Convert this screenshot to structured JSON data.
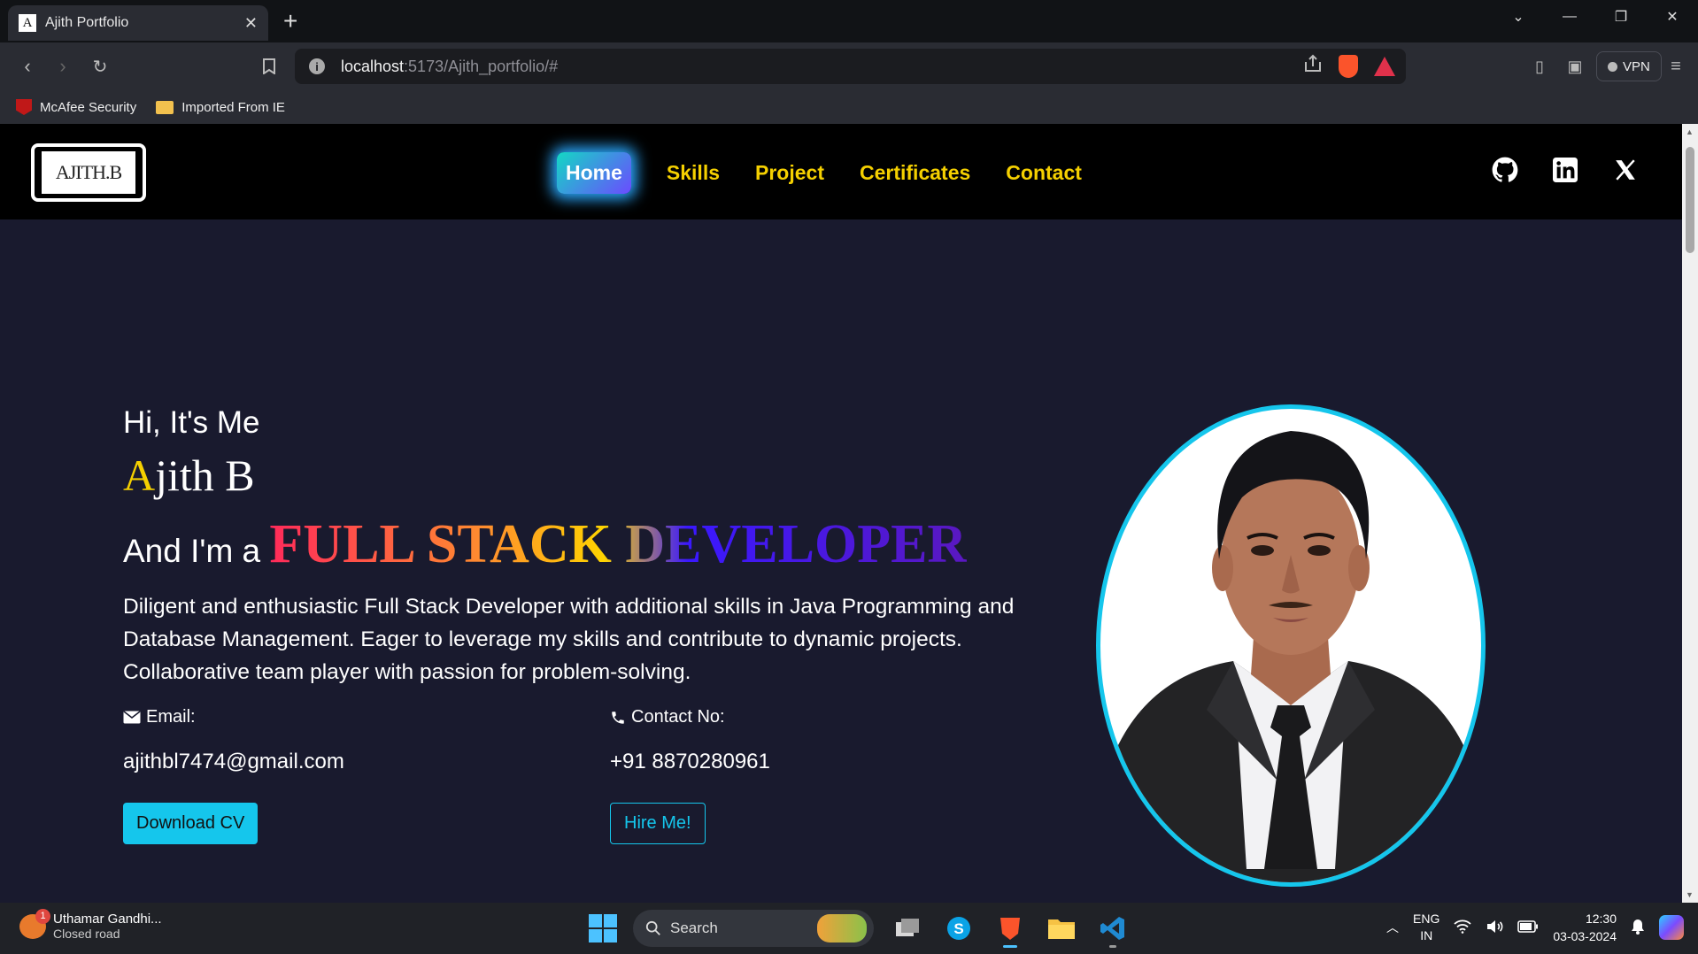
{
  "browser": {
    "tab_title": "Ajith Portfolio",
    "tab_favicon": "A",
    "url_host": "localhost",
    "url_path": ":5173/Ajith_portfolio/#",
    "vpn_label": "VPN",
    "bookmarks": [
      {
        "label": "McAfee Security",
        "icon": "mcafee-icon"
      },
      {
        "label": "Imported From IE",
        "icon": "folder-icon"
      }
    ]
  },
  "site": {
    "logo_text": "AJITH.B",
    "nav": [
      {
        "label": "Home",
        "active": true
      },
      {
        "label": "Skills"
      },
      {
        "label": "Project"
      },
      {
        "label": "Certificates"
      },
      {
        "label": "Contact"
      }
    ],
    "social": [
      "github-icon",
      "linkedin-icon",
      "x-icon"
    ]
  },
  "hero": {
    "greeting": "Hi, It's Me",
    "name_first_letter": "A",
    "name_rest": "jith B",
    "role_prefix": "And I'm a ",
    "role_title": "FULL STACK DEVELOPER",
    "description": "Diligent and enthusiastic Full Stack Developer with additional skills in Java Programming and Database Management. Eager to leverage my skills and contribute to dynamic projects. Collaborative team player with passion for problem-solving.",
    "email_label": "Email:",
    "email_value": "ajithbl7474@gmail.com",
    "contact_label": "Contact No:",
    "contact_value": "+91 8870280961",
    "download_button": "Download CV",
    "hire_button": "Hire Me!"
  },
  "taskbar": {
    "weather_badge": "1",
    "weather_title": "Uthamar Gandhi...",
    "weather_sub": "Closed road",
    "search_label": "Search",
    "lang_1": "ENG",
    "lang_2": "IN",
    "time": "12:30",
    "date": "03-03-2024"
  },
  "colors": {
    "accent": "#15c6ec",
    "nav_yellow": "#f5d000",
    "page_bg": "#191a2e"
  }
}
